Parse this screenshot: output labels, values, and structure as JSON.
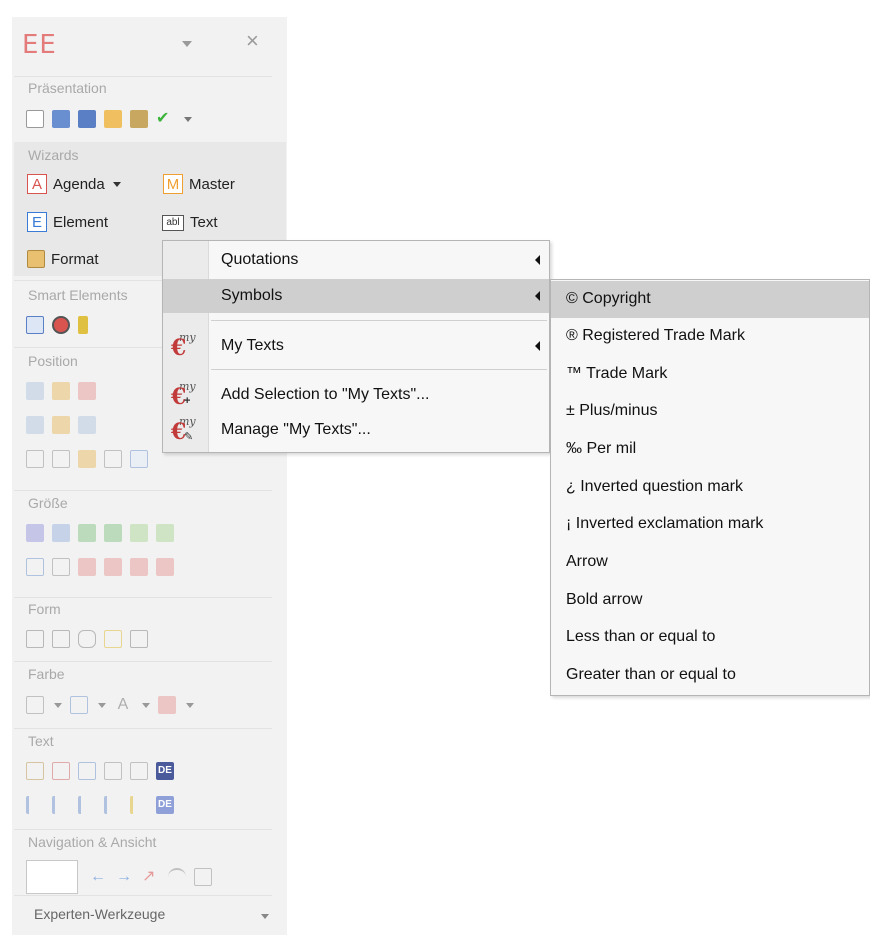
{
  "panel": {
    "title": "EE",
    "close_glyph": "×",
    "sections": {
      "presentation": "Präsentation",
      "wizards": "Wizards",
      "smart_elements": "Smart Elements",
      "position": "Position",
      "size": "Größe",
      "form": "Form",
      "color": "Farbe",
      "text": "Text",
      "navigation": "Navigation & Ansicht",
      "expert_tools": "Experten-Werkzeuge"
    },
    "wizards": {
      "agenda_letter": "A",
      "agenda_label": "Agenda",
      "master_letter": "M",
      "master_label": "Master",
      "element_letter": "E",
      "element_label": "Element",
      "text_icon": "abl",
      "text_label": "Text",
      "format_label": "Format"
    },
    "text_badges": [
      "DE",
      "DE"
    ],
    "colors": {
      "title": "#e37b7b",
      "agenda": "#d9534f",
      "master": "#f0a030",
      "element": "#3a7bd5",
      "accent_green": "#3cb43c"
    }
  },
  "menu1": {
    "items": [
      {
        "label": "Quotations",
        "has_submenu": true
      },
      {
        "label": "Symbols",
        "has_submenu": true,
        "highlighted": true
      },
      {
        "label": "My Texts",
        "has_submenu": true,
        "icon": "my-texts-icon"
      },
      {
        "label": "Add Selection to \"My Texts\"...",
        "icon": "my-texts-add-icon"
      },
      {
        "label": "Manage \"My Texts\"...",
        "icon": "my-texts-manage-icon"
      }
    ],
    "icon_caption": "my",
    "icon_glyph": "€"
  },
  "menu2": {
    "items": [
      {
        "label": "© Copyright",
        "highlighted": true
      },
      {
        "label": "® Registered Trade Mark"
      },
      {
        "label": "™ Trade Mark"
      },
      {
        "label": "± Plus/minus"
      },
      {
        "label": "‰ Per mil"
      },
      {
        "label": "¿ Inverted question mark"
      },
      {
        "label": "¡ Inverted exclamation mark"
      },
      {
        "label": "Arrow"
      },
      {
        "label": "Bold arrow"
      },
      {
        "label": "Less than or equal to"
      },
      {
        "label": "Greater than or equal to"
      }
    ]
  }
}
